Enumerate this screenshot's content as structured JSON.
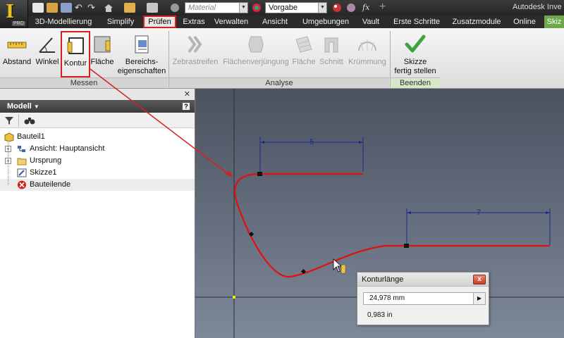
{
  "window": {
    "title": "Autodesk Inve"
  },
  "quick_access": {
    "material_placeholder": "Material",
    "appearance_value": "Vorgabe",
    "fx_label": "fx",
    "app_badge": "PRO"
  },
  "tabs": [
    {
      "label": "3D-Modellierung"
    },
    {
      "label": "Simplify"
    },
    {
      "label": "Prüfen",
      "active": true
    },
    {
      "label": "Extras"
    },
    {
      "label": "Verwalten"
    },
    {
      "label": "Ansicht"
    },
    {
      "label": "Umgebungen"
    },
    {
      "label": "Vault"
    },
    {
      "label": "Erste Schritte"
    },
    {
      "label": "Zusatzmodule"
    },
    {
      "label": "Online"
    },
    {
      "label": "Skiz"
    }
  ],
  "ribbon": {
    "panels": {
      "messen": "Messen",
      "analyse": "Analyse",
      "beenden": "Beenden"
    },
    "tools": {
      "abstand": "Abstand",
      "winkel": "Winkel",
      "kontur": "Kontur",
      "flaeche": "Fläche",
      "bereich_1": "Bereichs-",
      "bereich_2": "eigenschaften",
      "zebra": "Zebrastreifen",
      "verjuengung": "Flächenverjüngung",
      "flaeche_an": "Fläche",
      "schnitt": "Schnitt",
      "kruemmung": "Krümmung",
      "skizze_1": "Skizze",
      "skizze_2": "fertig stellen"
    }
  },
  "browser": {
    "title": "Modell",
    "help": "?",
    "close_glyph": "✕",
    "tree": [
      {
        "label": "Bauteil1"
      },
      {
        "label": "Ansicht: Hauptansicht"
      },
      {
        "label": "Ursprung"
      },
      {
        "label": "Skizze1"
      },
      {
        "label": "Bauteilende"
      }
    ]
  },
  "sketch": {
    "dimension_top": "5",
    "dimension_right": "7"
  },
  "contour_dialog": {
    "title": "Konturlänge",
    "close": "x",
    "length_mm": "24,978 mm",
    "length_in": "0,983 in",
    "unit_arrow": "▶"
  },
  "colors": {
    "highlight_red": "#d62020",
    "sketch_curve": "#e01010",
    "dimension": "#1a2a8a",
    "check_green": "#3aa53a"
  }
}
